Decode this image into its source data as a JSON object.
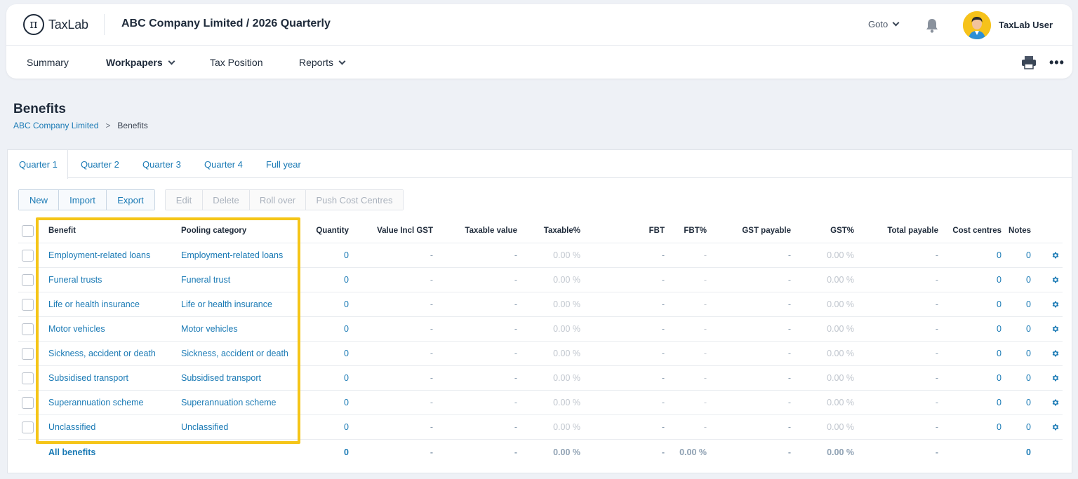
{
  "header": {
    "logo_text": "TaxLab",
    "logo_symbol": "π",
    "company_title": "ABC Company Limited / 2026 Quarterly",
    "goto_label": "Goto",
    "user_name": "TaxLab User"
  },
  "nav": {
    "items": [
      {
        "label": "Summary"
      },
      {
        "label": "Workpapers"
      },
      {
        "label": "Tax Position"
      },
      {
        "label": "Reports"
      }
    ],
    "more": "•••"
  },
  "page": {
    "title": "Benefits",
    "breadcrumb": {
      "parent": "ABC Company Limited",
      "separator": ">",
      "current": "Benefits"
    }
  },
  "tabs": [
    "Quarter 1",
    "Quarter 2",
    "Quarter 3",
    "Quarter 4",
    "Full year"
  ],
  "toolbar": {
    "primary": [
      "New",
      "Import",
      "Export"
    ],
    "disabled": [
      "Edit",
      "Delete",
      "Roll over",
      "Push Cost Centres"
    ]
  },
  "table": {
    "columns": {
      "benefit": "Benefit",
      "pooling": "Pooling category",
      "quantity": "Quantity",
      "value_gst": "Value Incl GST",
      "taxable_value": "Taxable value",
      "taxable_pct": "Taxable%",
      "fbt": "FBT",
      "fbt_pct": "FBT%",
      "gst_payable": "GST payable",
      "gst_pct": "GST%",
      "total_payable": "Total payable",
      "cost_centres": "Cost centres",
      "notes": "Notes"
    },
    "rows": [
      {
        "benefit": "Employment-related loans",
        "pooling": "Employment-related loans",
        "quantity": "0",
        "value_gst": "-",
        "taxable_value": "-",
        "taxable_pct": "0.00 %",
        "fbt": "-",
        "fbt_pct": "-",
        "gst_payable": "-",
        "gst_pct": "0.00 %",
        "total_payable": "-",
        "cost_centres": "0",
        "notes": "0"
      },
      {
        "benefit": "Funeral trusts",
        "pooling": "Funeral trust",
        "quantity": "0",
        "value_gst": "-",
        "taxable_value": "-",
        "taxable_pct": "0.00 %",
        "fbt": "-",
        "fbt_pct": "-",
        "gst_payable": "-",
        "gst_pct": "0.00 %",
        "total_payable": "-",
        "cost_centres": "0",
        "notes": "0"
      },
      {
        "benefit": "Life or health insurance",
        "pooling": "Life or health insurance",
        "quantity": "0",
        "value_gst": "-",
        "taxable_value": "-",
        "taxable_pct": "0.00 %",
        "fbt": "-",
        "fbt_pct": "-",
        "gst_payable": "-",
        "gst_pct": "0.00 %",
        "total_payable": "-",
        "cost_centres": "0",
        "notes": "0"
      },
      {
        "benefit": "Motor vehicles",
        "pooling": "Motor vehicles",
        "quantity": "0",
        "value_gst": "-",
        "taxable_value": "-",
        "taxable_pct": "0.00 %",
        "fbt": "-",
        "fbt_pct": "-",
        "gst_payable": "-",
        "gst_pct": "0.00 %",
        "total_payable": "-",
        "cost_centres": "0",
        "notes": "0"
      },
      {
        "benefit": "Sickness, accident or death",
        "pooling": "Sickness, accident or death",
        "quantity": "0",
        "value_gst": "-",
        "taxable_value": "-",
        "taxable_pct": "0.00 %",
        "fbt": "-",
        "fbt_pct": "-",
        "gst_payable": "-",
        "gst_pct": "0.00 %",
        "total_payable": "-",
        "cost_centres": "0",
        "notes": "0"
      },
      {
        "benefit": "Subsidised transport",
        "pooling": "Subsidised transport",
        "quantity": "0",
        "value_gst": "-",
        "taxable_value": "-",
        "taxable_pct": "0.00 %",
        "fbt": "-",
        "fbt_pct": "-",
        "gst_payable": "-",
        "gst_pct": "0.00 %",
        "total_payable": "-",
        "cost_centres": "0",
        "notes": "0"
      },
      {
        "benefit": "Superannuation scheme",
        "pooling": "Superannuation scheme",
        "quantity": "0",
        "value_gst": "-",
        "taxable_value": "-",
        "taxable_pct": "0.00 %",
        "fbt": "-",
        "fbt_pct": "-",
        "gst_payable": "-",
        "gst_pct": "0.00 %",
        "total_payable": "-",
        "cost_centres": "0",
        "notes": "0"
      },
      {
        "benefit": "Unclassified",
        "pooling": "Unclassified",
        "quantity": "0",
        "value_gst": "-",
        "taxable_value": "-",
        "taxable_pct": "0.00 %",
        "fbt": "-",
        "fbt_pct": "-",
        "gst_payable": "-",
        "gst_pct": "0.00 %",
        "total_payable": "-",
        "cost_centres": "0",
        "notes": "0"
      }
    ],
    "total": {
      "label": "All benefits",
      "quantity": "0",
      "value_gst": "-",
      "taxable_value": "-",
      "taxable_pct": "0.00 %",
      "fbt": "-",
      "fbt_pct": "0.00 %",
      "gst_payable": "-",
      "gst_pct": "0.00 %",
      "total_payable": "-",
      "notes": "0"
    }
  },
  "colors": {
    "link": "#1a7ab5",
    "highlight": "#f5c518",
    "text": "#1e2a3a"
  }
}
